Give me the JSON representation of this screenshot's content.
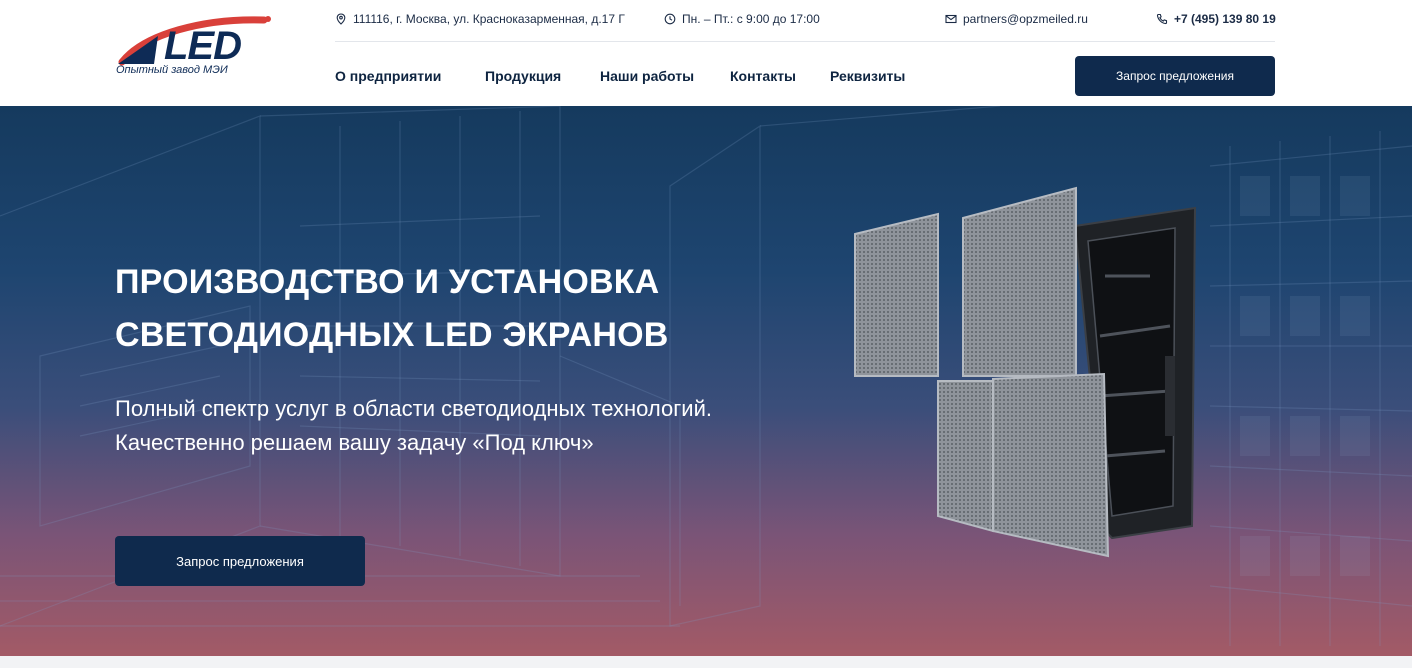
{
  "logo": {
    "mark": "LED",
    "subtitle": "Опытный завод МЭИ",
    "brand_color": "#0e2b56",
    "swoosh_color": "#d9403a"
  },
  "contacts": {
    "address": "111116, г. Москва, ул. Красноказарменная, д.17 Г",
    "address_icon": "map-pin-icon",
    "hours": "Пн. – Пт.: с 9:00 до 17:00",
    "hours_icon": "clock-icon",
    "email": "partners@opzmeiled.ru",
    "email_icon": "mail-icon",
    "phone": "+7 (495) 139 80 19",
    "phone_icon": "phone-icon"
  },
  "nav": {
    "items": [
      {
        "label": "О предприятии"
      },
      {
        "label": "Продукция"
      },
      {
        "label": "Наши работы"
      },
      {
        "label": "Контакты"
      },
      {
        "label": "Реквизиты"
      }
    ],
    "cta_label": "Запрос предложения"
  },
  "hero": {
    "title": "ПРОИЗВОДСТВО И УСТАНОВКА СВЕТОДИОДНЫХ LED ЭКРАНОВ",
    "subtitle": "Полный спектр услуг в области светодиодных технологий. Качественно решаем вашу задачу «Под ключ»",
    "cta_label": "Запрос предложения",
    "product_image": "led-panel-module-image"
  },
  "colors": {
    "primary_dark": "#0f2a4d",
    "text_dark": "#0e2440",
    "hero_top": "#153a5e",
    "hero_bottom": "#a35a66"
  }
}
